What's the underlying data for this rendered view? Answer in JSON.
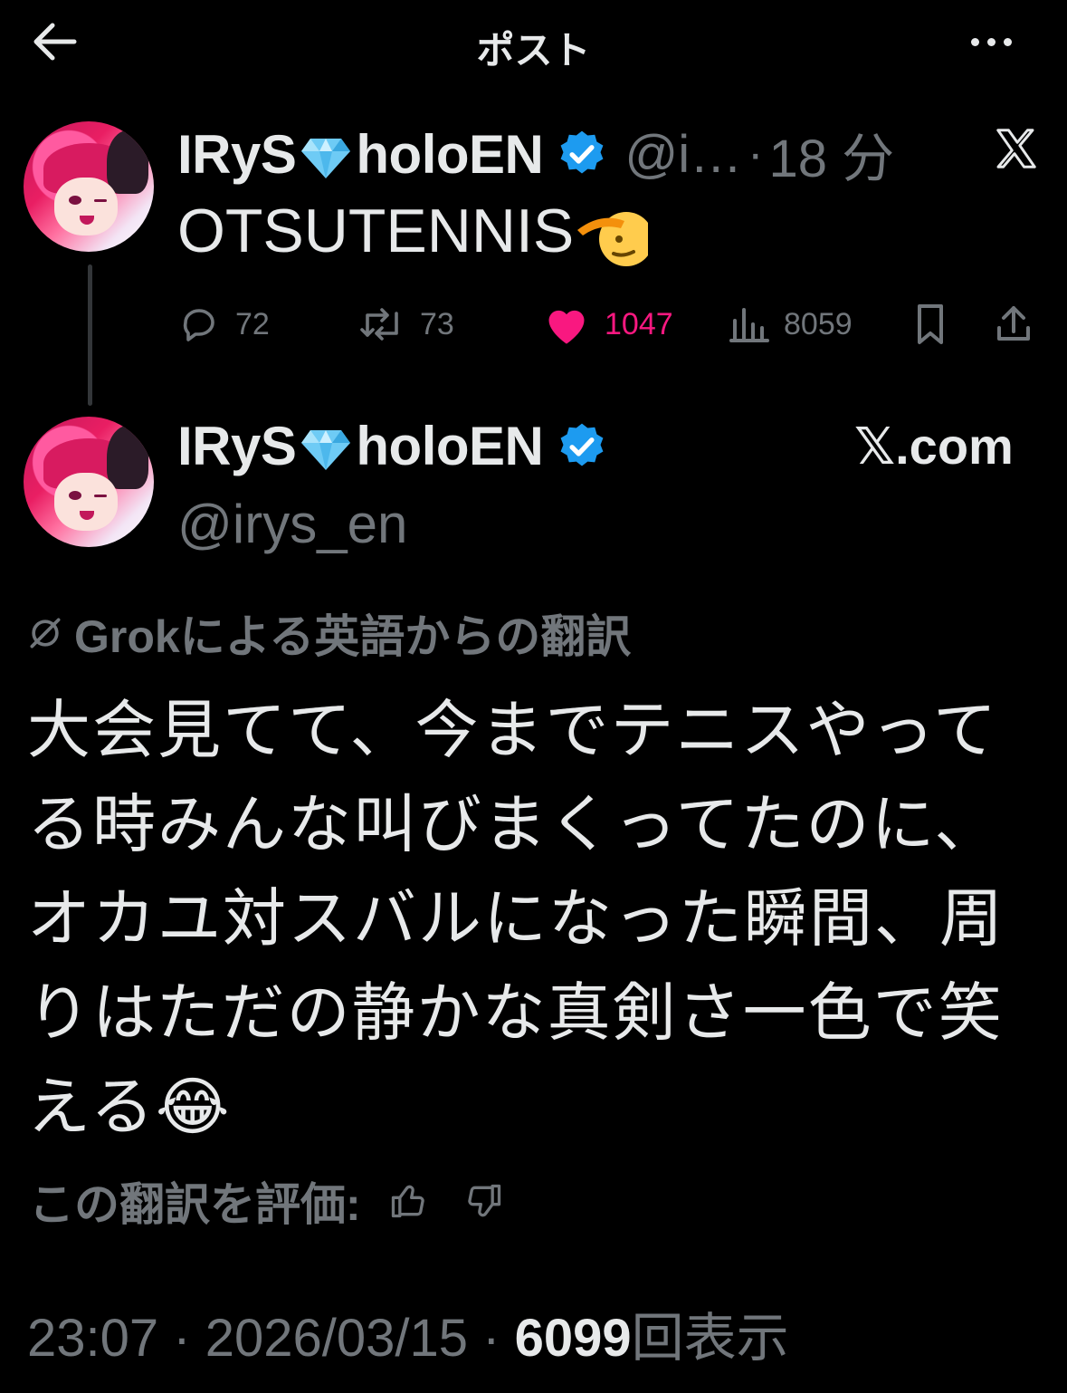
{
  "header": {
    "title": "ポスト",
    "back_icon": "arrow-left-icon",
    "more_icon": "more-dots-icon"
  },
  "reply_tweet": {
    "display_name_part1": "IRyS",
    "display_name_part2": "holoEN",
    "handle": "@i…",
    "separator": "·",
    "time": "18 分",
    "text": "OTSUTENNIS",
    "stats": {
      "replies": "72",
      "reposts": "73",
      "likes": "1047",
      "views": "8059"
    }
  },
  "quoted_card": {
    "display_name_part1": "IRyS",
    "display_name_part2": "holoEN",
    "handle": "@irys_en",
    "source": "𝕏.com"
  },
  "translation": {
    "note": "Grokによる英語からの翻訳",
    "text": "大会見てて、今までテニスやってる時みんな叫びまくってたのに、オカユ対スバルになった瞬間、周りはただの静かな真剣さ一色で笑える",
    "emoji": "😂",
    "rate_label": "この翻訳を評価:"
  },
  "footer": {
    "time": "23:07",
    "sep1": "·",
    "date": "2026/03/15",
    "sep2": "·",
    "views_count": "6099",
    "views_label": "回表示"
  },
  "colors": {
    "background": "#000000",
    "text": "#e7e9ea",
    "muted": "#71767b",
    "like": "#f91880",
    "verified": "#1d9bf0"
  }
}
